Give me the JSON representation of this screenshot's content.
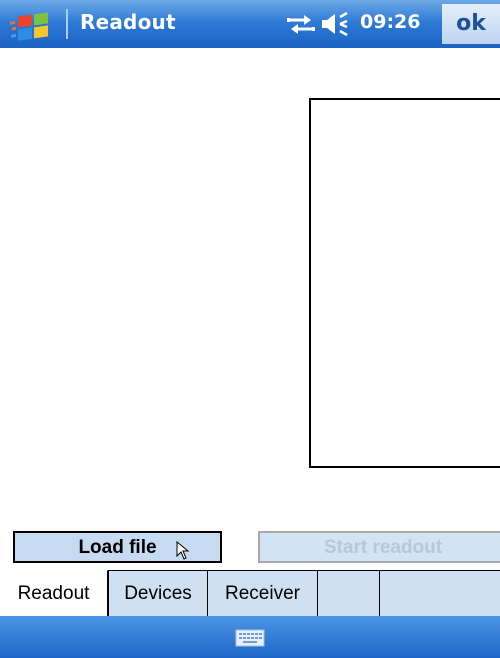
{
  "titlebar": {
    "title": "Readout",
    "time": "09:26",
    "ok_label": "ok",
    "start_icon": "windows-flag-icon",
    "connectivity_icon": "connectivity-icon",
    "volume_icon": "speaker-icon"
  },
  "actions": {
    "load_file_label": "Load file",
    "start_readout_label": "Start readout",
    "start_readout_enabled": false
  },
  "tabs": [
    {
      "label": "Readout",
      "active": true
    },
    {
      "label": "Devices",
      "active": false
    },
    {
      "label": "Receiver",
      "active": false
    },
    {
      "label": "",
      "active": false
    },
    {
      "label": "",
      "active": false
    }
  ],
  "menubar": {
    "input_icon": "keyboard-icon"
  },
  "colors": {
    "titlebar_blue": "#2f7bd6",
    "button_blue": "#c6dbf1",
    "tabstrip_blue": "#cfe0f3",
    "disabled_text": "#b8c8da"
  }
}
